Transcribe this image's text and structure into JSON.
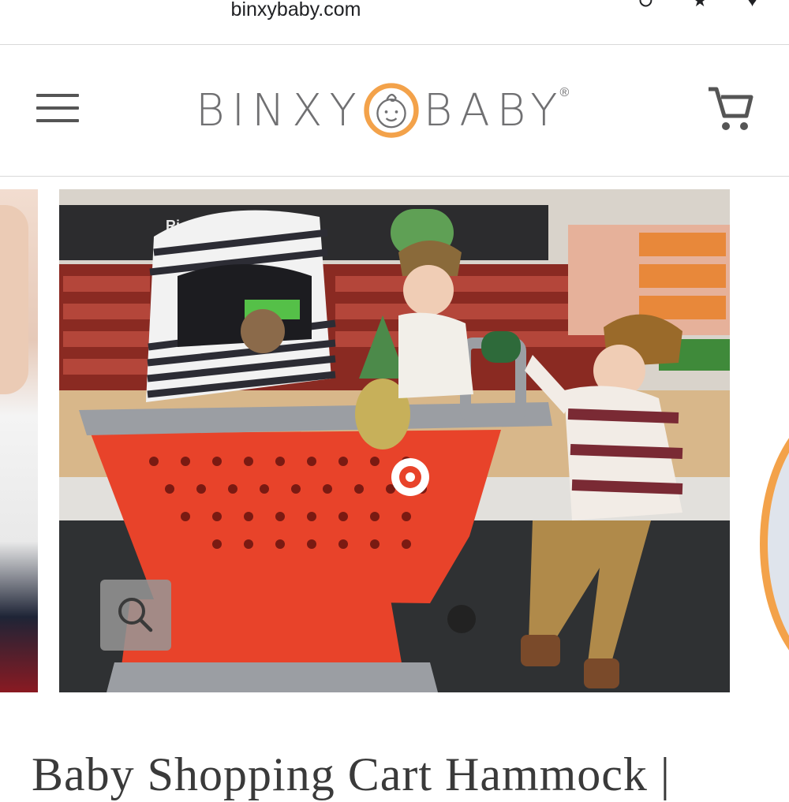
{
  "browser": {
    "url": "binxybaby.com",
    "icons": [
      "account-icon",
      "bookmark-icon",
      "heart-icon"
    ]
  },
  "header": {
    "logo_text_left": "BINXY",
    "logo_text_right": "BABY",
    "logo_registered": "®",
    "menu_icon": "hamburger-menu-icon",
    "cart_icon": "shopping-cart-icon"
  },
  "gallery": {
    "sign_text": "Ri   now.",
    "zoom_icon": "magnifier-icon"
  },
  "product": {
    "title": "Baby Shopping Cart Hammock |"
  },
  "colors": {
    "logo_orange": "#f3a24a",
    "logo_gray": "#707072",
    "cart_red": "#e8432a"
  }
}
